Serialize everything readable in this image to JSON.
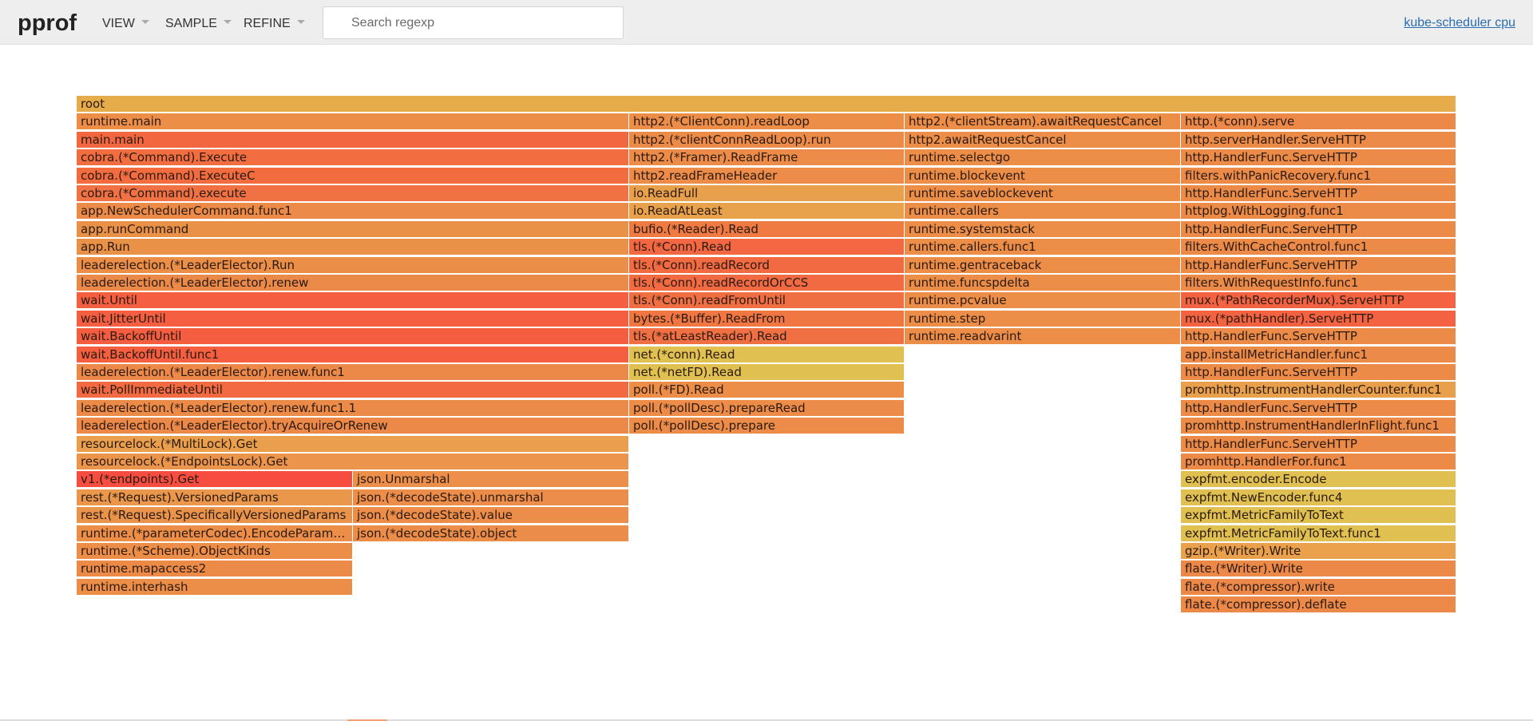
{
  "header": {
    "title": "pprof",
    "menus": [
      {
        "label": "VIEW"
      },
      {
        "label": "SAMPLE"
      },
      {
        "label": "REFINE"
      }
    ],
    "search_placeholder": "Search regexp",
    "profile_link": "kube-scheduler cpu"
  },
  "colors": {
    "header_bg": "#eeeeee",
    "link": "#2a6db0",
    "frame_red": "#f65f3f",
    "frame_orange": "#ec8d48",
    "frame_yellow": "#dfc050"
  },
  "flame": {
    "columns": [
      {
        "frames": [
          {
            "name": "root",
            "color": "#e6ac4a"
          }
        ]
      },
      {
        "frames": [
          {
            "name": "runtime.main",
            "color": "#ec8d48"
          },
          {
            "name": "main.main",
            "color": "#f2673f"
          },
          {
            "name": "cobra.(*Command).Execute",
            "color": "#f26d40"
          },
          {
            "name": "cobra.(*Command).ExecuteC",
            "color": "#f26c40"
          },
          {
            "name": "cobra.(*Command).execute",
            "color": "#f07144"
          },
          {
            "name": "app.NewSchedulerCommand.func1",
            "color": "#ec8a47"
          },
          {
            "name": "app.runCommand",
            "color": "#ea9148"
          },
          {
            "name": "app.Run",
            "color": "#ea9148"
          },
          {
            "name": "leaderelection.(*LeaderElector).Run",
            "color": "#ea8e48"
          },
          {
            "name": "leaderelection.(*LeaderElector).renew",
            "color": "#eb8948"
          },
          {
            "name": "wait.Until",
            "color": "#f55f40"
          },
          {
            "name": "wait.JitterUntil",
            "color": "#f55e40"
          },
          {
            "name": "wait.BackoffUntil",
            "color": "#f55d40"
          },
          {
            "name": "wait.BackoffUntil.func1",
            "color": "#f55f40"
          },
          {
            "name": "leaderelection.(*LeaderElector).renew.func1",
            "color": "#ec8848"
          },
          {
            "name": "wait.PollImmediateUntil",
            "color": "#f36a42"
          },
          {
            "name": "leaderelection.(*LeaderElector).renew.func1.1",
            "color": "#ec8a48"
          },
          {
            "name": "leaderelection.(*LeaderElector).tryAcquireOrRenew",
            "color": "#ec8948"
          },
          {
            "name": "resourcelock.(*MultiLock).Get",
            "color": "#e99f4c"
          },
          {
            "name": "resourcelock.(*EndpointsLock).Get",
            "color": "#eb944b"
          }
        ]
      },
      {
        "frames": [
          {
            "name": "v1.(*endpoints).Get",
            "color": "#f64d40"
          },
          {
            "name": "rest.(*Request).VersionedParams",
            "color": "#ea974b"
          },
          {
            "name": "rest.(*Request).SpecificallyVersionedParams",
            "color": "#ea944b"
          },
          {
            "name": "runtime.(*parameterCodec).EncodeParameters",
            "color": "#ec8d48"
          },
          {
            "name": "runtime.(*Scheme).ObjectKinds",
            "color": "#ec8d48"
          },
          {
            "name": "runtime.mapaccess2",
            "color": "#ec8a47"
          },
          {
            "name": "runtime.interhash",
            "color": "#ec8d48"
          }
        ]
      },
      {
        "frames": [
          {
            "name": "json.Unmarshal",
            "color": "#ec8f4a"
          },
          {
            "name": "json.(*decodeState).unmarshal",
            "color": "#ec8d49"
          },
          {
            "name": "json.(*decodeState).value",
            "color": "#ec8d49"
          },
          {
            "name": "json.(*decodeState).object",
            "color": "#ec8c49"
          }
        ]
      },
      {
        "frames": [
          {
            "name": "http2.(*ClientConn).readLoop",
            "color": "#ec8d48"
          },
          {
            "name": "http2.(*clientConnReadLoop).run",
            "color": "#ec8a48"
          },
          {
            "name": "http2.(*Framer).ReadFrame",
            "color": "#ec8c48"
          },
          {
            "name": "http2.readFrameHeader",
            "color": "#ec8c48"
          },
          {
            "name": "io.ReadFull",
            "color": "#e9a04c"
          },
          {
            "name": "io.ReadAtLeast",
            "color": "#e9a24c"
          },
          {
            "name": "bufio.(*Reader).Read",
            "color": "#ef7a42"
          },
          {
            "name": "tls.(*Conn).Read",
            "color": "#f36842"
          },
          {
            "name": "tls.(*Conn).readRecord",
            "color": "#f26a41"
          },
          {
            "name": "tls.(*Conn).readRecordOrCCS",
            "color": "#f26a41"
          },
          {
            "name": "tls.(*Conn).readFromUntil",
            "color": "#f06f42"
          },
          {
            "name": "bytes.(*Buffer).ReadFrom",
            "color": "#f07642"
          },
          {
            "name": "tls.(*atLeastReader).Read",
            "color": "#f07043"
          },
          {
            "name": "net.(*conn).Read",
            "color": "#dfc050"
          },
          {
            "name": "net.(*netFD).Read",
            "color": "#dfc050"
          },
          {
            "name": "poll.(*FD).Read",
            "color": "#ec8d48"
          },
          {
            "name": "poll.(*pollDesc).prepareRead",
            "color": "#ec8c48"
          },
          {
            "name": "poll.(*pollDesc).prepare",
            "color": "#ec8c48"
          }
        ]
      },
      {
        "frames": [
          {
            "name": "http2.(*clientStream).awaitRequestCancel",
            "color": "#ec8d48"
          },
          {
            "name": "http2.awaitRequestCancel",
            "color": "#ec8d48"
          },
          {
            "name": "runtime.selectgo",
            "color": "#ec8d48"
          },
          {
            "name": "runtime.blockevent",
            "color": "#ec8d48"
          },
          {
            "name": "runtime.saveblockevent",
            "color": "#ec8d48"
          },
          {
            "name": "runtime.callers",
            "color": "#ec8d48"
          },
          {
            "name": "runtime.systemstack",
            "color": "#ec8d48"
          },
          {
            "name": "runtime.callers.func1",
            "color": "#ec8d48"
          },
          {
            "name": "runtime.gentraceback",
            "color": "#ec8d48"
          },
          {
            "name": "runtime.funcspdelta",
            "color": "#ec8d48"
          },
          {
            "name": "runtime.pcvalue",
            "color": "#ec8d48"
          },
          {
            "name": "runtime.step",
            "color": "#ec8d48"
          },
          {
            "name": "runtime.readvarint",
            "color": "#ec8d48"
          }
        ]
      },
      {
        "frames": [
          {
            "name": "http.(*conn).serve",
            "color": "#ec8848"
          },
          {
            "name": "http.serverHandler.ServeHTTP",
            "color": "#ec8a48"
          },
          {
            "name": "http.HandlerFunc.ServeHTTP",
            "color": "#ec8b48"
          },
          {
            "name": "filters.withPanicRecovery.func1",
            "color": "#ec8b48"
          },
          {
            "name": "http.HandlerFunc.ServeHTTP",
            "color": "#ec8b48"
          },
          {
            "name": "httplog.WithLogging.func1",
            "color": "#ec8a48"
          },
          {
            "name": "http.HandlerFunc.ServeHTTP",
            "color": "#ec8b48"
          },
          {
            "name": "filters.WithCacheControl.func1",
            "color": "#ec8a48"
          },
          {
            "name": "http.HandlerFunc.ServeHTTP",
            "color": "#ec8b48"
          },
          {
            "name": "filters.WithRequestInfo.func1",
            "color": "#ec8a48"
          },
          {
            "name": "mux.(*PathRecorderMux).ServeHTTP",
            "color": "#f36342"
          },
          {
            "name": "mux.(*pathHandler).ServeHTTP",
            "color": "#f36342"
          },
          {
            "name": "http.HandlerFunc.ServeHTTP",
            "color": "#ec8b48"
          },
          {
            "name": "app.installMetricHandler.func1",
            "color": "#ec8a48"
          },
          {
            "name": "http.HandlerFunc.ServeHTTP",
            "color": "#ec8b48"
          },
          {
            "name": "promhttp.InstrumentHandlerCounter.func1",
            "color": "#e9a04c"
          },
          {
            "name": "http.HandlerFunc.ServeHTTP",
            "color": "#ec8b48"
          },
          {
            "name": "promhttp.InstrumentHandlerInFlight.func1",
            "color": "#ec8a48"
          },
          {
            "name": "http.HandlerFunc.ServeHTTP",
            "color": "#ec8b48"
          },
          {
            "name": "promhttp.HandlerFor.func1",
            "color": "#ec8a48"
          },
          {
            "name": "expfmt.encoder.Encode",
            "color": "#dfc050"
          },
          {
            "name": "expfmt.NewEncoder.func4",
            "color": "#dfc050"
          },
          {
            "name": "expfmt.MetricFamilyToText",
            "color": "#dfc050"
          },
          {
            "name": "expfmt.MetricFamilyToText.func1",
            "color": "#dfc050"
          },
          {
            "name": "gzip.(*Writer).Write",
            "color": "#eba04c"
          },
          {
            "name": "flate.(*Writer).Write",
            "color": "#ec8848"
          },
          {
            "name": "flate.(*compressor).write",
            "color": "#ec8848"
          },
          {
            "name": "flate.(*compressor).deflate",
            "color": "#ec8848"
          }
        ]
      }
    ]
  }
}
